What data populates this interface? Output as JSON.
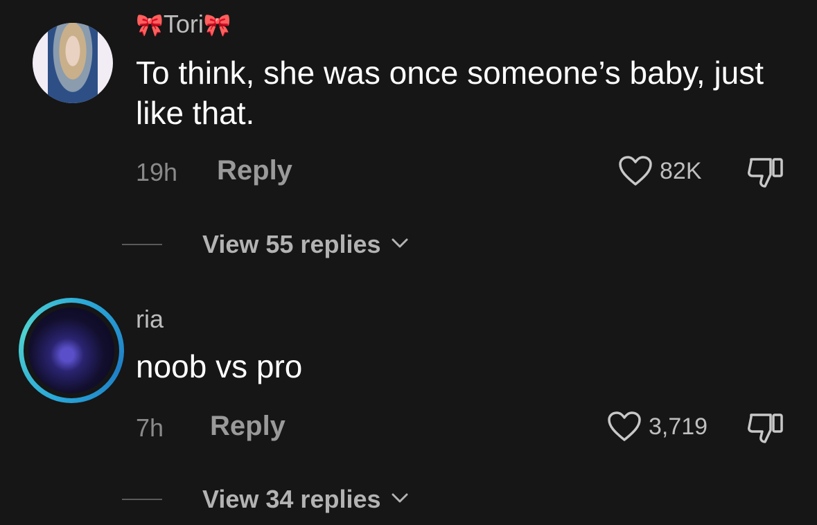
{
  "comments": [
    {
      "username": "Tori",
      "username_decoration": "🎀",
      "text": "To think, she was once someone’s baby, just like that.",
      "time": "19h",
      "reply_label": "Reply",
      "likes": "82K",
      "view_replies_label": "View 55 replies"
    },
    {
      "username": "ria",
      "text": "noob vs pro",
      "time": "7h",
      "reply_label": "Reply",
      "likes": "3,719",
      "view_replies_label": "View 34 replies"
    }
  ],
  "colors": {
    "background": "#161616",
    "text_primary": "#ffffff",
    "text_secondary": "#8a8a8a",
    "story_ring": "#2aa8d8",
    "bow": "#ff7aa8"
  },
  "icons": {
    "like": "heart-outline-icon",
    "dislike": "thumbs-down-icon",
    "expand": "chevron-down-icon"
  }
}
